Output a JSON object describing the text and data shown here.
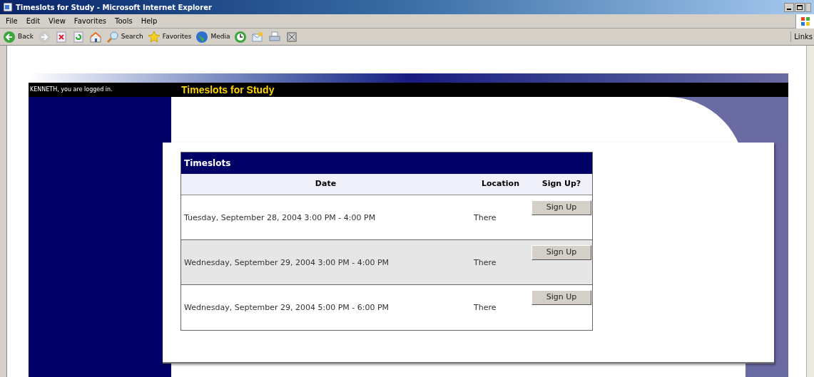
{
  "window": {
    "title": "Timeslots for Study - Microsoft Internet Explorer"
  },
  "menu": [
    "File",
    "Edit",
    "View",
    "Favorites",
    "Tools",
    "Help"
  ],
  "toolbar": [
    {
      "kind": "back",
      "label": "Back"
    },
    {
      "kind": "forward"
    },
    {
      "kind": "stop"
    },
    {
      "kind": "refresh"
    },
    {
      "kind": "home"
    },
    {
      "kind": "search",
      "label": "Search"
    },
    {
      "kind": "favorites",
      "label": "Favorites"
    },
    {
      "kind": "media",
      "label": "Media"
    },
    {
      "kind": "history"
    },
    {
      "kind": "mail"
    },
    {
      "kind": "print"
    },
    {
      "kind": "edit"
    }
  ],
  "links_label": "Links",
  "page": {
    "user_status": "KENNETH, you are logged in.",
    "heading": "Timeslots for Study",
    "table": {
      "title": "Timeslots",
      "columns": [
        "Date",
        "Location",
        "Sign Up?"
      ],
      "rows": [
        {
          "date": "Tuesday, September 28, 2004 3:00 PM - 4:00 PM",
          "location": "There",
          "action": "Sign Up"
        },
        {
          "date": "Wednesday, September 29, 2004 3:00 PM - 4:00 PM",
          "location": "There",
          "action": "Sign Up"
        },
        {
          "date": "Wednesday, September 29, 2004 5:00 PM - 6:00 PM",
          "location": "There",
          "action": "Sign Up"
        }
      ]
    }
  }
}
